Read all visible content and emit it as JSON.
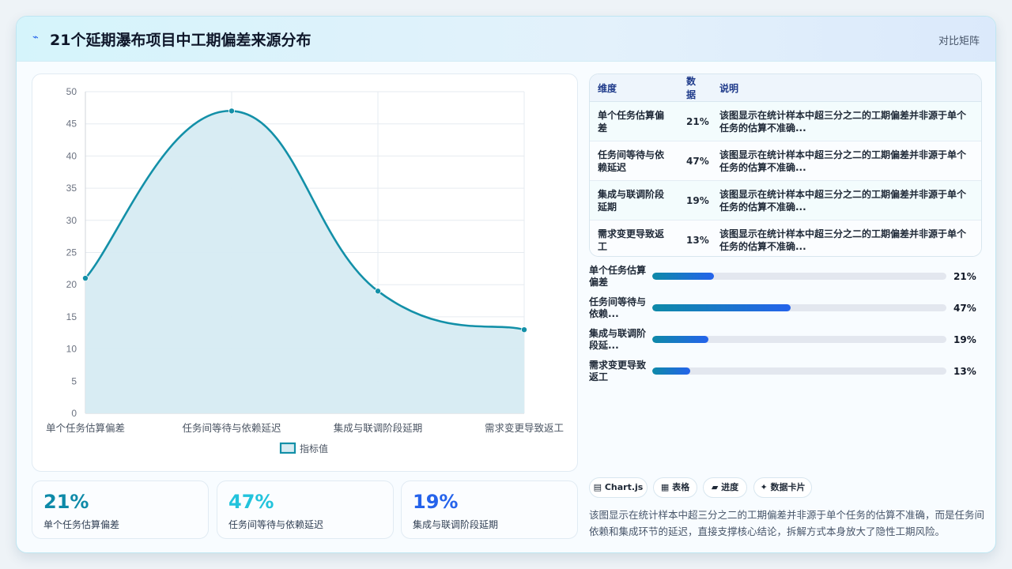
{
  "header": {
    "title": "21个延期瀑布项目中工期偏差来源分布",
    "tag": "对比矩阵"
  },
  "chart_data": {
    "type": "line",
    "categories": [
      "单个任务估算偏差",
      "任务间等待与依赖延迟",
      "集成与联调阶段延期",
      "需求变更导致返工"
    ],
    "series": [
      {
        "name": "指标值",
        "values": [
          21,
          47,
          19,
          13
        ]
      }
    ],
    "ylim": [
      0,
      50
    ],
    "yticks": [
      0,
      5,
      10,
      15,
      20,
      25,
      30,
      35,
      40,
      45,
      50
    ],
    "grid": true,
    "area_fill": true,
    "legend": "bottom",
    "colors": {
      "line": "#1390a8",
      "fill": "#d6ebf2"
    }
  },
  "stats": [
    {
      "value": "21%",
      "label": "单个任务估算偏差",
      "color": "#0e8aa8"
    },
    {
      "value": "47%",
      "label": "任务间等待与依赖延迟",
      "color": "#22c3dc"
    },
    {
      "value": "19%",
      "label": "集成与联调阶段延期",
      "color": "#2563eb"
    }
  ],
  "table": {
    "headers": [
      "维度",
      "数据",
      "说明"
    ],
    "rows": [
      {
        "dim": "单个任务估算偏差",
        "value": "21%",
        "desc": "该图显示在统计样本中超三分之二的工期偏差并非源于单个任务的估算不准确..."
      },
      {
        "dim": "任务间等待与依赖延迟",
        "value": "47%",
        "desc": "该图显示在统计样本中超三分之二的工期偏差并非源于单个任务的估算不准确..."
      },
      {
        "dim": "集成与联调阶段延期",
        "value": "19%",
        "desc": "该图显示在统计样本中超三分之二的工期偏差并非源于单个任务的估算不准确..."
      },
      {
        "dim": "需求变更导致返工",
        "value": "13%",
        "desc": "该图显示在统计样本中超三分之二的工期偏差并非源于单个任务的估算不准确..."
      }
    ]
  },
  "progress": [
    {
      "label": "单个任务估算偏差",
      "value": "21%",
      "fraction": 0.21
    },
    {
      "label": "任务间等待与依赖...",
      "value": "47%",
      "fraction": 0.47
    },
    {
      "label": "集成与联调阶段延...",
      "value": "19%",
      "fraction": 0.19
    },
    {
      "label": "需求变更导致返工",
      "value": "13%",
      "fraction": 0.13
    }
  ],
  "chips": [
    {
      "icon": "chart-icon",
      "label": "▤ Chart.js"
    },
    {
      "icon": "table-icon",
      "label": "▦ 表格"
    },
    {
      "icon": "progress-icon",
      "label": "▰ 进度"
    },
    {
      "icon": "card-icon",
      "label": "✦ 数据卡片"
    }
  ],
  "summary": "该图显示在统计样本中超三分之二的工期偏差并非源于单个任务的估算不准确，而是任务间依赖和集成环节的延迟，直接支撑核心结论，拆解方式本身放大了隐性工期风险。"
}
